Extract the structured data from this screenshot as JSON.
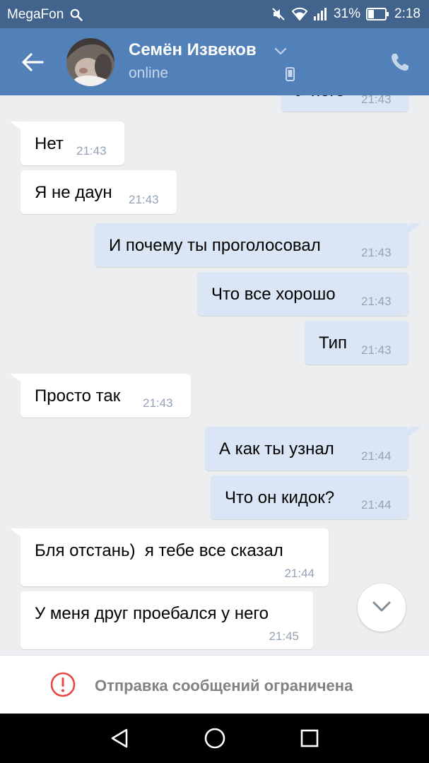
{
  "status_bar": {
    "carrier": "MegaFon",
    "battery": "31%",
    "time": "2:18"
  },
  "header": {
    "contact_name": "Семён Извеков",
    "status": "online"
  },
  "messages": [
    {
      "direction": "out",
      "text": "У него",
      "time": "21:43"
    },
    {
      "direction": "in",
      "text": "Нет",
      "time": "21:43"
    },
    {
      "direction": "in",
      "text": "Я не даун",
      "time": "21:43"
    },
    {
      "direction": "out",
      "text": "И почему ты проголосовал",
      "time": "21:43"
    },
    {
      "direction": "out",
      "text": "Что все хорошо",
      "time": "21:43"
    },
    {
      "direction": "out",
      "text": "Тип",
      "time": "21:43"
    },
    {
      "direction": "in",
      "text": "Просто так",
      "time": "21:43"
    },
    {
      "direction": "out",
      "text": "А как ты узнал",
      "time": "21:44"
    },
    {
      "direction": "out",
      "text": "Что он кидок?",
      "time": "21:44"
    },
    {
      "direction": "in",
      "text": "Бля отстань)  я тебе все сказал",
      "time": "21:44"
    },
    {
      "direction": "in",
      "text": "У меня друг проебался у него",
      "time": "21:45"
    }
  ],
  "composer": {
    "restricted_text": "Отправка сообщений ограничена"
  },
  "colors": {
    "status_bar": "#42648c",
    "header": "#5181b8",
    "chat_background": "#edeef0",
    "incoming_bubble": "#ffffff",
    "outgoing_bubble": "#dae6f5",
    "warning": "#e64646"
  }
}
